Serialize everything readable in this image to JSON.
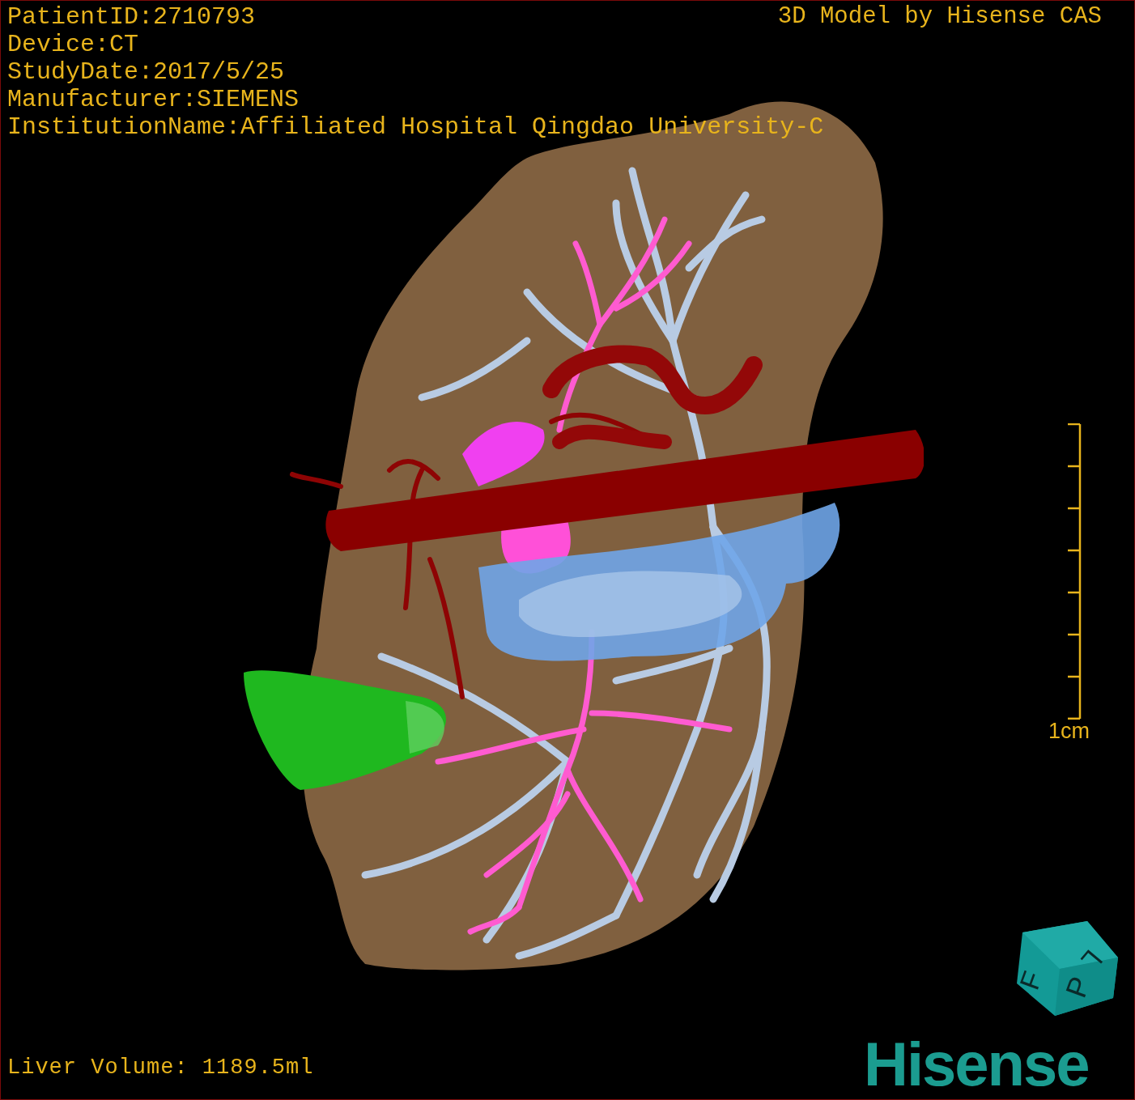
{
  "header": {
    "info_lines": [
      "PatientID:2710793",
      "Device:CT",
      "StudyDate:2017/5/25",
      "Manufacturer:SIEMENS",
      "InstitutionName:Affiliated Hospital Qingdao University-C"
    ],
    "credit": "3D Model by Hisense CAS"
  },
  "scale_bar": {
    "label": "1cm"
  },
  "orientation_cube": {
    "faces": [
      "L",
      "P",
      "F"
    ]
  },
  "footer": {
    "liver_volume": "Liver Volume: 1189.5ml"
  },
  "logo": {
    "text": "Hisense"
  }
}
